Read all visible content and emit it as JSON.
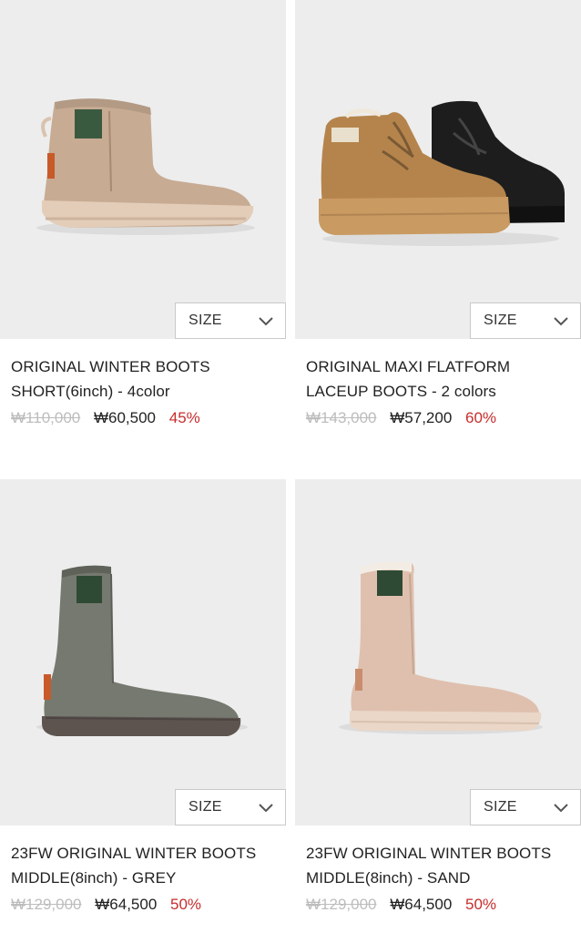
{
  "products": [
    {
      "name_line1": "ORIGINAL WINTER BOOTS",
      "name_line2": "SHORT(6inch) - 4color",
      "original_price": "₩110,000",
      "sale_price": "₩60,500",
      "discount": "45%",
      "size_label": "SIZE",
      "colors": {
        "boot": "#c7ab93",
        "sole": "#e3cdb9",
        "dark": "#a88a72"
      }
    },
    {
      "name_line1": "ORIGINAL MAXI FLATFORM",
      "name_line2": "LACEUP BOOTS - 2 colors",
      "original_price": "₩143,000",
      "sale_price": "₩57,200",
      "discount": "60%",
      "size_label": "SIZE",
      "colors": {
        "boot": "#b5844c",
        "sole": "#c99a62",
        "dark": "#1d1d1d"
      }
    },
    {
      "name_line1": "23FW ORIGINAL WINTER BOOTS",
      "name_line2": "MIDDLE(8inch) - GREY",
      "original_price": "₩129,000",
      "sale_price": "₩64,500",
      "discount": "50%",
      "size_label": "SIZE",
      "colors": {
        "boot": "#75796f",
        "sole": "#5d5450",
        "dark": "#5c5f57"
      }
    },
    {
      "name_line1": "23FW ORIGINAL WINTER BOOTS",
      "name_line2": "MIDDLE(8inch) - SAND",
      "original_price": "₩129,000",
      "sale_price": "₩64,500",
      "discount": "50%",
      "size_label": "SIZE",
      "colors": {
        "boot": "#dfc0ae",
        "sole": "#ead7c8",
        "dark": "#c6a693"
      }
    }
  ],
  "accent": {
    "discount_color": "#c62d2d",
    "strike_color": "#bdbdbd"
  }
}
